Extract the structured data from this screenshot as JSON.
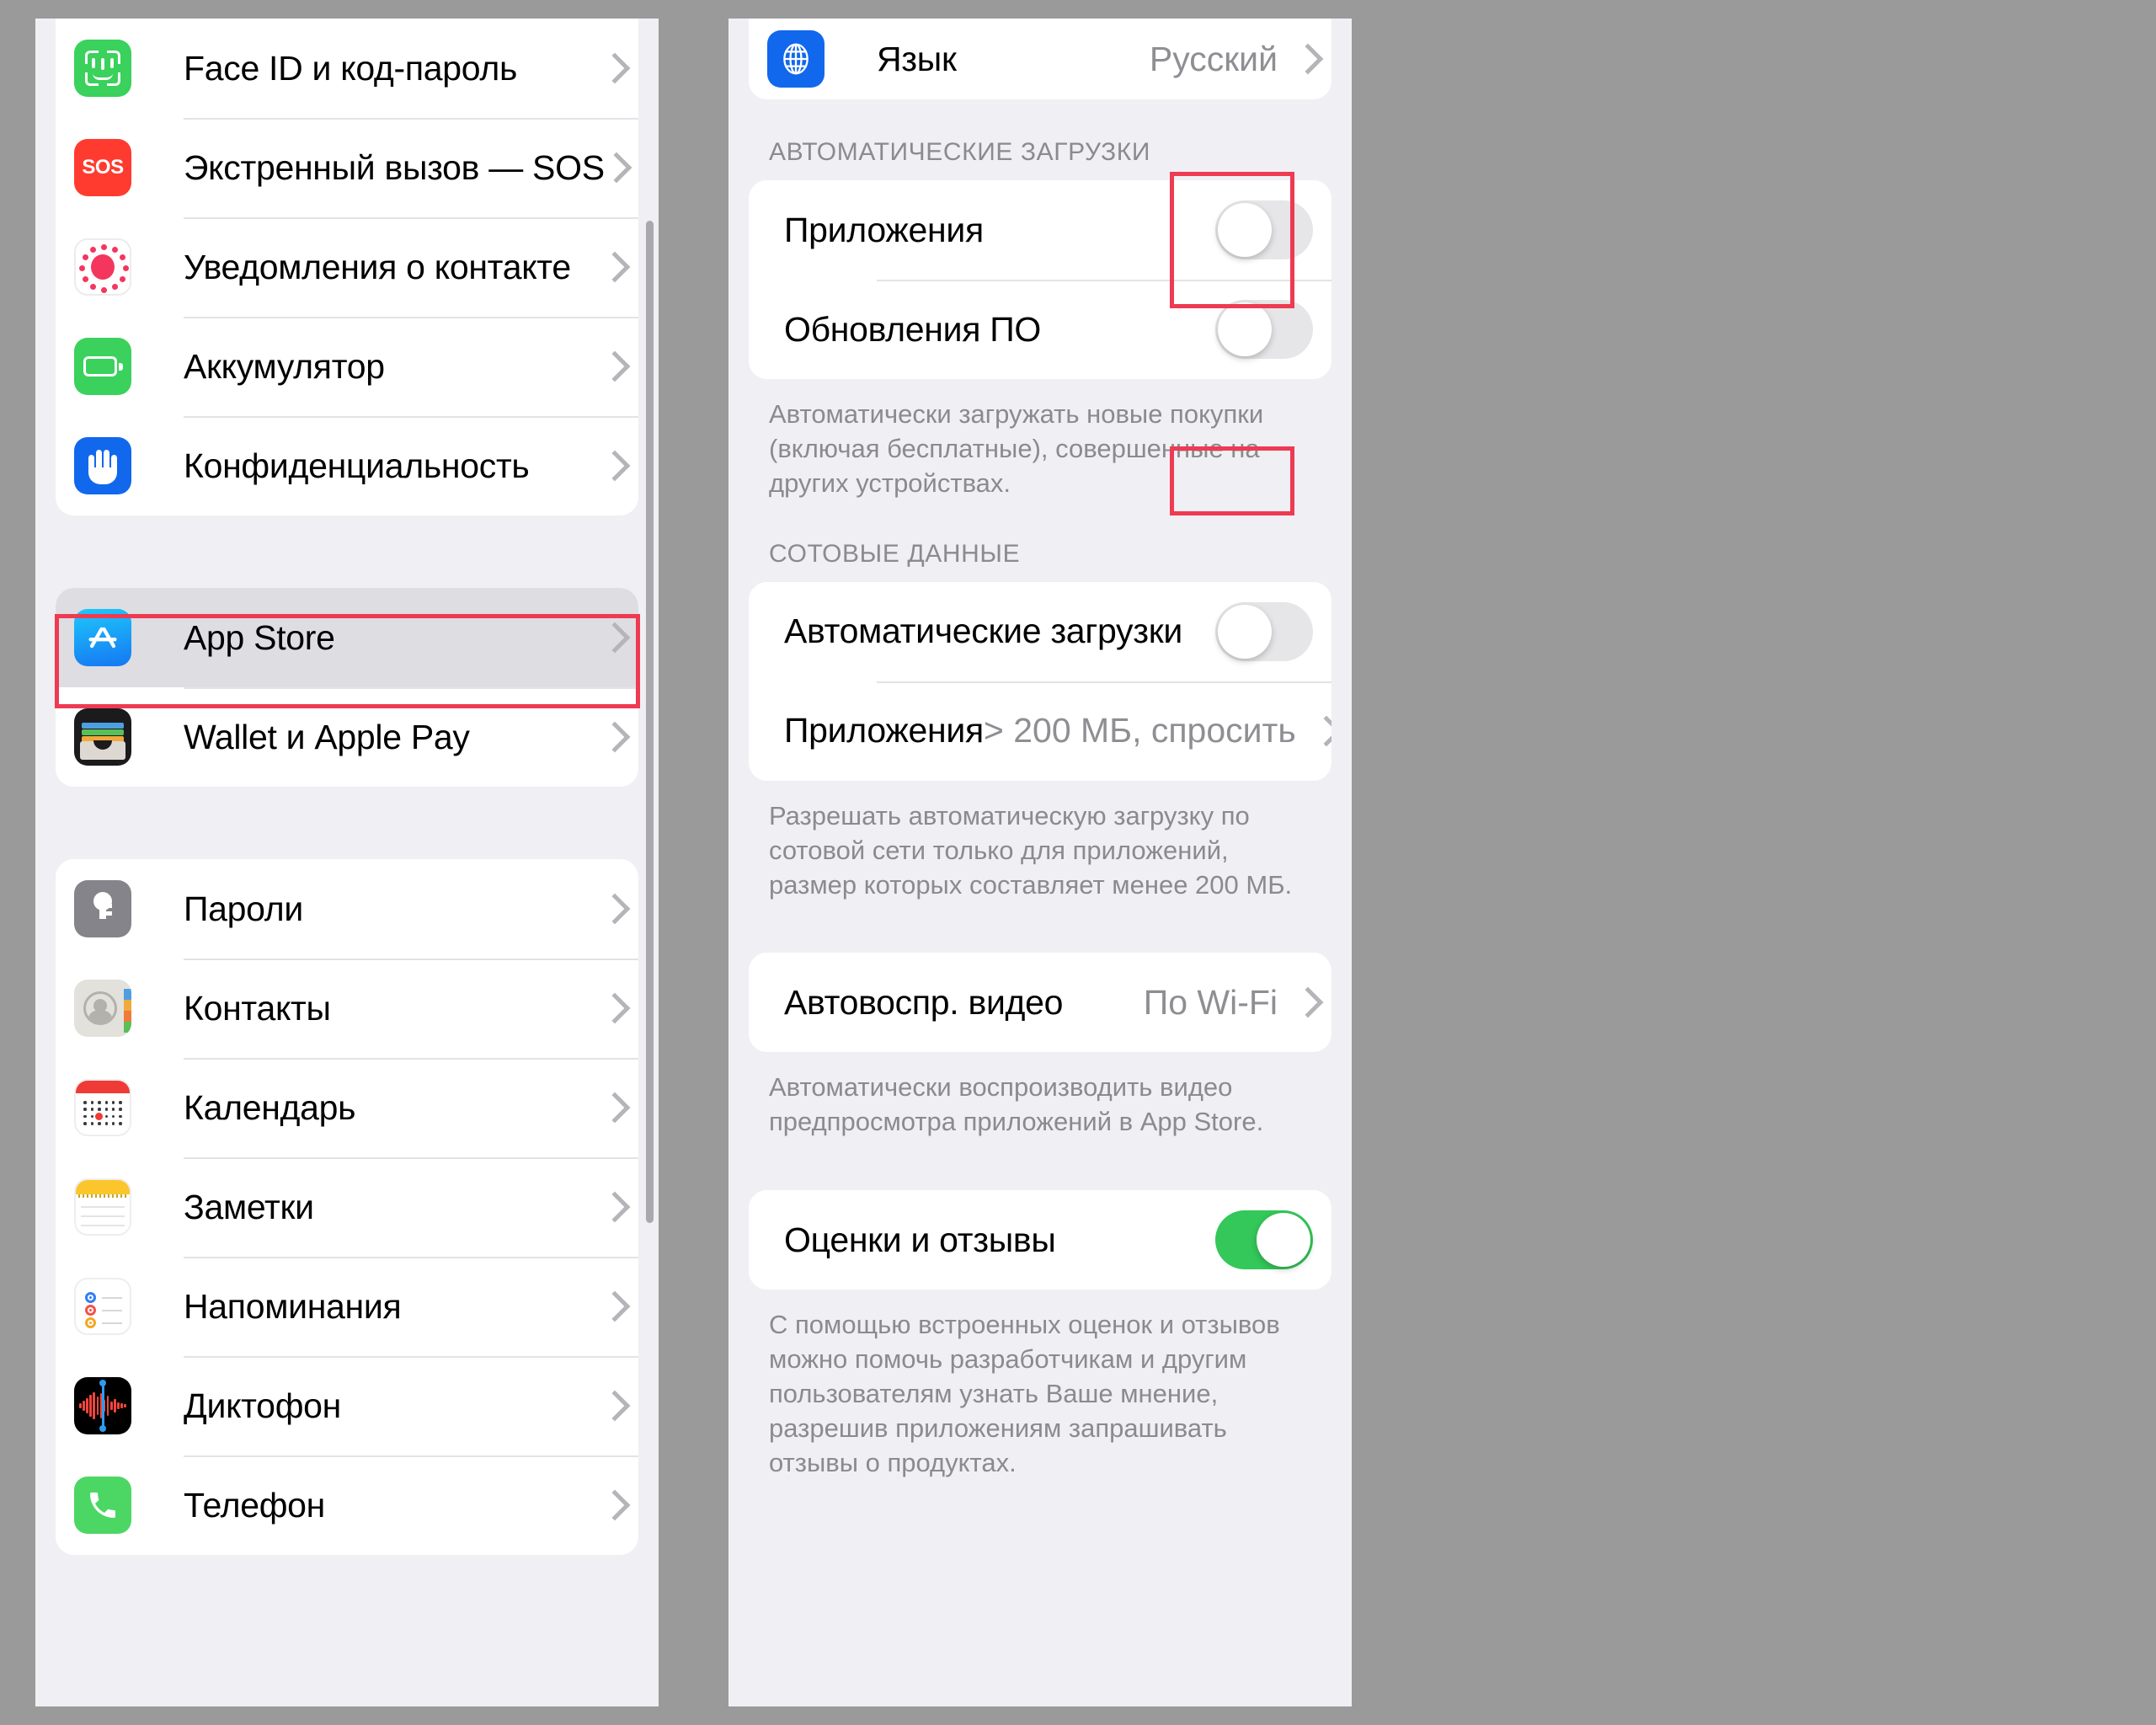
{
  "left_panel": {
    "group_1": {
      "rows": [
        {
          "label": "Face ID и код-пароль",
          "icon": "faceid-icon"
        },
        {
          "label": "Экстренный вызов — SOS",
          "icon": "sos-icon",
          "icon_text": "SOS"
        },
        {
          "label": "Уведомления о контакте",
          "icon": "contact-notifications-icon"
        },
        {
          "label": "Аккумулятор",
          "icon": "battery-icon"
        },
        {
          "label": "Конфиденциальность",
          "icon": "privacy-hand-icon"
        }
      ]
    },
    "group_2": {
      "rows": [
        {
          "label": "App Store",
          "icon": "app-store-icon",
          "selected": true,
          "highlighted": true
        },
        {
          "label": "Wallet и Apple Pay",
          "icon": "wallet-icon"
        }
      ]
    },
    "group_3": {
      "rows": [
        {
          "label": "Пароли",
          "icon": "key-icon"
        },
        {
          "label": "Контакты",
          "icon": "contacts-icon"
        },
        {
          "label": "Календарь",
          "icon": "calendar-icon"
        },
        {
          "label": "Заметки",
          "icon": "notes-icon"
        },
        {
          "label": "Напоминания",
          "icon": "reminders-icon"
        },
        {
          "label": "Диктофон",
          "icon": "voice-memos-icon"
        },
        {
          "label": "Телефон",
          "icon": "phone-icon"
        }
      ]
    }
  },
  "right_panel": {
    "language_row": {
      "label": "Язык",
      "value": "Русский",
      "icon": "globe-icon"
    },
    "auto_downloads": {
      "header": "АВТОМАТИЧЕСКИЕ ЗАГРУЗКИ",
      "rows": [
        {
          "label": "Приложения",
          "toggle": "off",
          "highlighted": true
        },
        {
          "label": "Обновления ПО",
          "toggle": "off",
          "highlighted": true
        }
      ],
      "footer": "Автоматически загружать новые покупки (включая бесплатные), совершенные на других устройствах."
    },
    "cellular_data": {
      "header": "СОТОВЫЕ ДАННЫЕ",
      "rows": [
        {
          "label": "Автоматические загрузки",
          "toggle": "off",
          "highlighted": true
        },
        {
          "label": "Приложения",
          "value": "> 200 МБ, спросить"
        }
      ],
      "footer": "Разрешать автоматическую загрузку по сотовой сети только для приложений, размер которых составляет менее 200 МБ."
    },
    "video_autoplay": {
      "rows": [
        {
          "label": "Автовоспр. видео",
          "value": "По Wi-Fi"
        }
      ],
      "footer": "Автоматически воспроизводить видео предпросмотра приложений в App Store."
    },
    "ratings": {
      "rows": [
        {
          "label": "Оценки и отзывы",
          "toggle": "on"
        }
      ],
      "footer": "С помощью встроенных оценок и отзывов можно помочь разработчикам и другим пользователям узнать Ваше мнение, разрешив приложениям запрашивать отзывы о продуктах."
    }
  },
  "colors": {
    "highlight_red": "#ee3a52",
    "toggle_on_green": "#34c759",
    "accent_blue": "#1168ec",
    "panel_bg": "#f0eff4"
  }
}
